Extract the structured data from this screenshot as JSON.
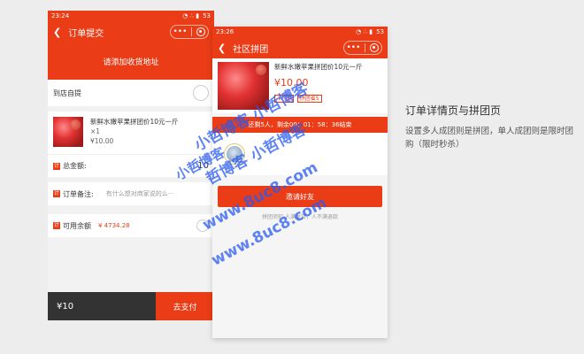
{
  "phone1": {
    "status": {
      "time": "23:24",
      "battery": "53"
    },
    "title": "订单提交",
    "address_prompt": "请添加收货地址",
    "pickup_label": "到店自提",
    "product": {
      "name": "新鲜水嫩苹果拼团价10元一斤",
      "qty": "×1",
      "price": "¥10.00"
    },
    "total_label": "总金额:",
    "total_value": "10",
    "note_label": "订单备注:",
    "note_placeholder": "有什么想对商家说的么···",
    "balance_label": "可用余额",
    "balance_value": "¥ 4734.28",
    "footer_total": "¥10",
    "pay_button": "去支付",
    "tag_glyph": "计"
  },
  "phone2": {
    "status": {
      "time": "23:26",
      "battery": "53"
    },
    "title": "社区拼团",
    "product": {
      "name": "新鲜水嫩苹果拼团价10元一斤",
      "price": "¥10.00",
      "tag1": "4人团",
      "tag2": "拼团省5"
    },
    "countdown": "还剩5人，剩余00：01：58：36结束",
    "invite_button": "邀请好友",
    "rules": "拼团须知·人满发货，人不满退款"
  },
  "description": {
    "title": "订单详情页与拼团页",
    "body": "设置多人成团则是拼团，单人成团则是限时团购（限时秒杀）"
  },
  "watermark": {
    "line1": "小哲博客 小哲博客",
    "line2": "哲博客 小哲博客",
    "line3": "www.8uc8.com",
    "line4": "www.8uc8.com",
    "line5": "小哲博客"
  },
  "colors": {
    "accent": "#ea3c16",
    "dark_bar": "#333333"
  },
  "icons": [
    "back-arrow-icon",
    "more-dots-icon",
    "target-icon",
    "radio-icon",
    "apple-photo",
    "avatar"
  ]
}
